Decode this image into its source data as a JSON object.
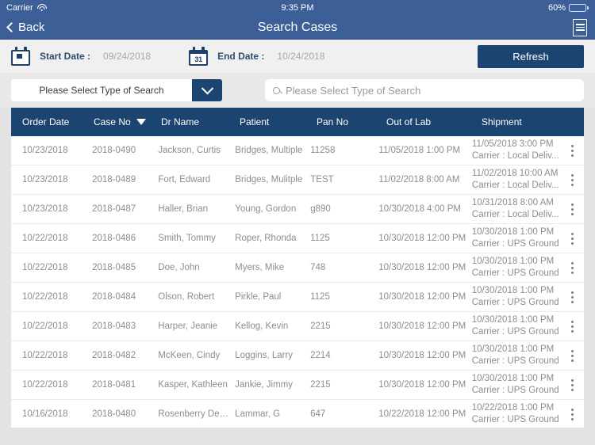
{
  "status_bar": {
    "carrier": "Carrier",
    "wifi_icon": "wifi-icon",
    "time": "9:35 PM",
    "battery_percent": "60%",
    "battery_level": 60
  },
  "nav": {
    "back_label": "Back",
    "back_icon": "chevron-left-icon",
    "title": "Search Cases",
    "menu_icon": "list-icon"
  },
  "filters": {
    "start_icon": "calendar-icon",
    "start_label": "Start Date :",
    "start_value": "09/24/2018",
    "end_icon": "calendar-31-icon",
    "end_day": "31",
    "end_label": "End Date :",
    "end_value": "10/24/2018",
    "refresh_label": "Refresh"
  },
  "search": {
    "select_value": "Please Select Type of Search",
    "select_arrow_icon": "chevron-down-icon",
    "search_icon": "search-icon",
    "placeholder": "Please Select Type of Search",
    "input_value": ""
  },
  "table": {
    "columns": [
      {
        "key": "order_date",
        "label": "Order Date"
      },
      {
        "key": "case_no",
        "label": "Case No",
        "sorted": true,
        "sort_icon": "caret-down-icon"
      },
      {
        "key": "dr_name",
        "label": "Dr Name"
      },
      {
        "key": "patient",
        "label": "Patient"
      },
      {
        "key": "pan_no",
        "label": "Pan No"
      },
      {
        "key": "out_of_lab",
        "label": "Out of Lab"
      },
      {
        "key": "shipment",
        "label": "Shipment"
      }
    ],
    "row_menu_icon": "kebab-menu-icon",
    "rows": [
      {
        "order_date": "10/23/2018",
        "case_no": "2018-0490",
        "dr_name": "Jackson, Curtis",
        "patient": "Bridges, Multiple",
        "pan_no": "11258",
        "out_of_lab": "11/05/2018 1:00 PM",
        "ship_datetime": "11/05/2018 3:00 PM",
        "ship_carrier": "Carrier :  Local Deliv..."
      },
      {
        "order_date": "10/23/2018",
        "case_no": "2018-0489",
        "dr_name": "Fort, Edward",
        "patient": "Bridges, Mulitple",
        "pan_no": "TEST",
        "out_of_lab": "11/02/2018 8:00 AM",
        "ship_datetime": "11/02/2018 10:00 AM",
        "ship_carrier": "Carrier :  Local Deliv..."
      },
      {
        "order_date": "10/23/2018",
        "case_no": "2018-0487",
        "dr_name": "Haller, Brian",
        "patient": "Young, Gordon",
        "pan_no": "g890",
        "out_of_lab": "10/30/2018 4:00 PM",
        "ship_datetime": "10/31/2018 8:00 AM",
        "ship_carrier": "Carrier :  Local Deliv..."
      },
      {
        "order_date": "10/22/2018",
        "case_no": "2018-0486",
        "dr_name": "Smith, Tommy",
        "patient": "Roper, Rhonda",
        "pan_no": "1125",
        "out_of_lab": "10/30/2018 12:00 PM",
        "ship_datetime": "10/30/2018 1:00 PM",
        "ship_carrier": "Carrier :  UPS Ground"
      },
      {
        "order_date": "10/22/2018",
        "case_no": "2018-0485",
        "dr_name": "Doe, John",
        "patient": "Myers, Mike",
        "pan_no": "748",
        "out_of_lab": "10/30/2018 12:00 PM",
        "ship_datetime": "10/30/2018 1:00 PM",
        "ship_carrier": "Carrier :  UPS Ground"
      },
      {
        "order_date": "10/22/2018",
        "case_no": "2018-0484",
        "dr_name": "Olson, Robert",
        "patient": "Pirkle, Paul",
        "pan_no": "1125",
        "out_of_lab": "10/30/2018 12:00 PM",
        "ship_datetime": "10/30/2018 1:00 PM",
        "ship_carrier": "Carrier :  UPS Ground"
      },
      {
        "order_date": "10/22/2018",
        "case_no": "2018-0483",
        "dr_name": "Harper, Jeanie",
        "patient": "Kellog, Kevin",
        "pan_no": "2215",
        "out_of_lab": "10/30/2018 12:00 PM",
        "ship_datetime": "10/30/2018 1:00 PM",
        "ship_carrier": "Carrier :  UPS Ground"
      },
      {
        "order_date": "10/22/2018",
        "case_no": "2018-0482",
        "dr_name": "McKeen, Cindy",
        "patient": "Loggins, Larry",
        "pan_no": "2214",
        "out_of_lab": "10/30/2018 12:00 PM",
        "ship_datetime": "10/30/2018 1:00 PM",
        "ship_carrier": "Carrier :  UPS Ground"
      },
      {
        "order_date": "10/22/2018",
        "case_no": "2018-0481",
        "dr_name": "Kasper, Kathleen",
        "patient": "Jankie, Jimmy",
        "pan_no": "2215",
        "out_of_lab": "10/30/2018 12:00 PM",
        "ship_datetime": "10/30/2018 1:00 PM",
        "ship_carrier": "Carrier :  UPS Ground"
      },
      {
        "order_date": "10/16/2018",
        "case_no": "2018-0480",
        "dr_name": "Rosenberry Dent...",
        "patient": "Lammar, G",
        "pan_no": "647",
        "out_of_lab": "10/22/2018 12:00 PM",
        "ship_datetime": "10/22/2018 1:00 PM",
        "ship_carrier": "Carrier :  UPS Ground"
      }
    ]
  },
  "colors": {
    "nav_blue": "#3b5f96",
    "accent_dark_blue": "#1c4470",
    "page_bg": "#e3e3e3",
    "battery_green": "#4cd964"
  }
}
